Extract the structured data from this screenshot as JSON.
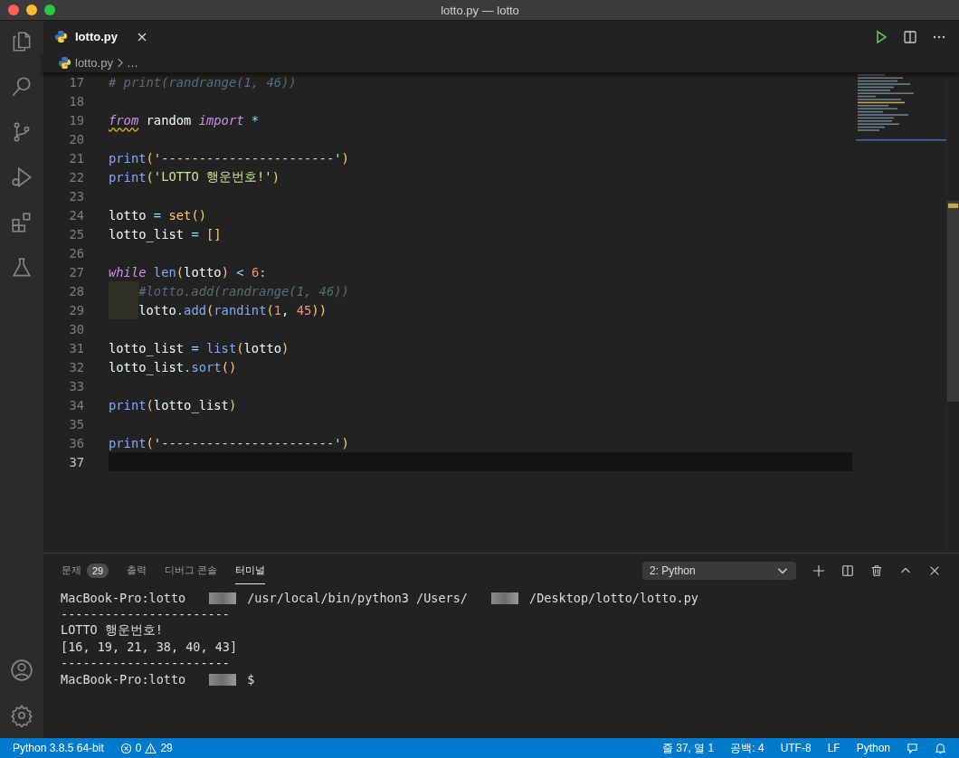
{
  "window": {
    "title": "lotto.py — lotto"
  },
  "editor_tabs": [
    {
      "label": "lotto.py",
      "selected": true
    }
  ],
  "breadcrumb": [
    "lotto.py",
    "…"
  ],
  "code": [
    {
      "number": "17",
      "current": false,
      "indent": false,
      "tokens": [
        {
          "kind": "cmt",
          "text": "# print(randrange(1, 46))"
        }
      ]
    },
    {
      "number": "18",
      "current": false,
      "indent": false
    },
    {
      "number": "19",
      "current": false,
      "indent": false,
      "tokens": [
        {
          "kind": "kw",
          "text": "from",
          "warning": true
        },
        {
          "kind": "var",
          "text": " random "
        },
        {
          "kind": "kw",
          "text": "import"
        },
        {
          "kind": "op",
          "text": " *"
        }
      ]
    },
    {
      "number": "20",
      "current": false,
      "indent": false
    },
    {
      "number": "21",
      "current": false,
      "indent": false,
      "tokens": [
        {
          "kind": "fn",
          "text": "print"
        },
        {
          "kind": "punc",
          "text": "("
        },
        {
          "kind": "str",
          "text": "'-----------------------'"
        },
        {
          "kind": "punc",
          "text": ")"
        }
      ]
    },
    {
      "number": "22",
      "current": false,
      "indent": false,
      "tokens": [
        {
          "kind": "fn",
          "text": "print"
        },
        {
          "kind": "punc",
          "text": "("
        },
        {
          "kind": "str",
          "text": "'LOTTO 행운번호!'"
        },
        {
          "kind": "punc",
          "text": ")"
        }
      ]
    },
    {
      "number": "23",
      "current": false,
      "indent": false
    },
    {
      "number": "24",
      "current": false,
      "indent": false,
      "tokens": [
        {
          "kind": "var",
          "text": "lotto "
        },
        {
          "kind": "op",
          "text": "="
        },
        {
          "kind": "punc",
          "text": " set()"
        }
      ]
    },
    {
      "number": "25",
      "current": false,
      "indent": false,
      "tokens": [
        {
          "kind": "var",
          "text": "lotto_list "
        },
        {
          "kind": "op",
          "text": "="
        },
        {
          "kind": "punc",
          "text": " []"
        }
      ]
    },
    {
      "number": "26",
      "current": false,
      "indent": false
    },
    {
      "number": "27",
      "current": false,
      "indent": false,
      "tokens": [
        {
          "kind": "kw",
          "text": "while"
        },
        {
          "kind": "fn",
          "text": " len"
        },
        {
          "kind": "punc",
          "text": "("
        },
        {
          "kind": "var",
          "text": "lotto"
        },
        {
          "kind": "punc",
          "text": ")"
        },
        {
          "kind": "op",
          "text": " <"
        },
        {
          "kind": "num",
          "text": " 6"
        },
        {
          "kind": "op",
          "text": ":"
        }
      ]
    },
    {
      "number": "28",
      "current": false,
      "indent": true,
      "tokens": [
        {
          "kind": "cmt",
          "text": "#lotto.add(randrange(1, 46))"
        }
      ]
    },
    {
      "number": "29",
      "current": false,
      "indent": true,
      "tokens": [
        {
          "kind": "var",
          "text": "lotto"
        },
        {
          "kind": "op",
          "text": "."
        },
        {
          "kind": "fn",
          "text": "add"
        },
        {
          "kind": "punc",
          "text": "("
        },
        {
          "kind": "fn",
          "text": "randint"
        },
        {
          "kind": "punc",
          "text": "("
        },
        {
          "kind": "num",
          "text": "1"
        },
        {
          "kind": "var",
          "text": ", "
        },
        {
          "kind": "num",
          "text": "45"
        },
        {
          "kind": "punc",
          "text": "))"
        }
      ]
    },
    {
      "number": "30",
      "current": false,
      "indent": false
    },
    {
      "number": "31",
      "current": false,
      "indent": false,
      "tokens": [
        {
          "kind": "var",
          "text": "lotto_list "
        },
        {
          "kind": "op",
          "text": "="
        },
        {
          "kind": "fn",
          "text": " list"
        },
        {
          "kind": "punc",
          "text": "("
        },
        {
          "kind": "var",
          "text": "lotto"
        },
        {
          "kind": "punc",
          "text": ")"
        }
      ]
    },
    {
      "number": "32",
      "current": false,
      "indent": false,
      "tokens": [
        {
          "kind": "var",
          "text": "lotto_list"
        },
        {
          "kind": "op",
          "text": "."
        },
        {
          "kind": "fn",
          "text": "sort"
        },
        {
          "kind": "punc",
          "text": "()"
        }
      ]
    },
    {
      "number": "33",
      "current": false,
      "indent": false
    },
    {
      "number": "34",
      "current": false,
      "indent": false,
      "tokens": [
        {
          "kind": "fn",
          "text": "print"
        },
        {
          "kind": "punc",
          "text": "("
        },
        {
          "kind": "var",
          "text": "lotto_list"
        },
        {
          "kind": "punc",
          "text": ")"
        }
      ]
    },
    {
      "number": "35",
      "current": false,
      "indent": false
    },
    {
      "number": "36",
      "current": false,
      "indent": false,
      "tokens": [
        {
          "kind": "fn",
          "text": "print"
        },
        {
          "kind": "punc",
          "text": "("
        },
        {
          "kind": "str",
          "text": "'-----------------------'"
        },
        {
          "kind": "punc",
          "text": ")"
        }
      ]
    },
    {
      "number": "37",
      "current": true,
      "indent": false
    }
  ],
  "panel_tabs": [
    {
      "label": "문제",
      "badge": "29",
      "selected": false
    },
    {
      "label": "출력",
      "selected": false
    },
    {
      "label": "디버그 콘솔",
      "selected": false
    },
    {
      "label": "터미널",
      "selected": true
    }
  ],
  "terminal_select": {
    "value": "2: Python"
  },
  "terminal": [
    [
      {
        "kind": "text",
        "text": "MacBook-Pro:lotto"
      },
      {
        "kind": "redacted"
      },
      {
        "kind": "text",
        "text": "/usr/local/bin/python3 /Users/"
      },
      {
        "kind": "redacted"
      },
      {
        "kind": "text",
        "text": "/Desktop/lotto/lotto.py"
      }
    ],
    [
      {
        "kind": "text",
        "text": "-----------------------"
      }
    ],
    [
      {
        "kind": "text",
        "text": "LOTTO 행운번호!"
      }
    ],
    [
      {
        "kind": "text",
        "text": "[16, 19, 21, 38, 40, 43]"
      }
    ],
    [
      {
        "kind": "text",
        "text": "-----------------------"
      }
    ],
    [
      {
        "kind": "text",
        "text": "MacBook-Pro:lotto"
      },
      {
        "kind": "redacted"
      },
      {
        "kind": "text",
        "text": "$"
      }
    ]
  ],
  "status_bar": {
    "interpreter": "Python 3.8.5 64-bit",
    "errors": "0",
    "warnings": "29",
    "right": [
      "줄 37, 열 1",
      "공백: 4",
      "UTF-8",
      "LF",
      "Python"
    ]
  }
}
